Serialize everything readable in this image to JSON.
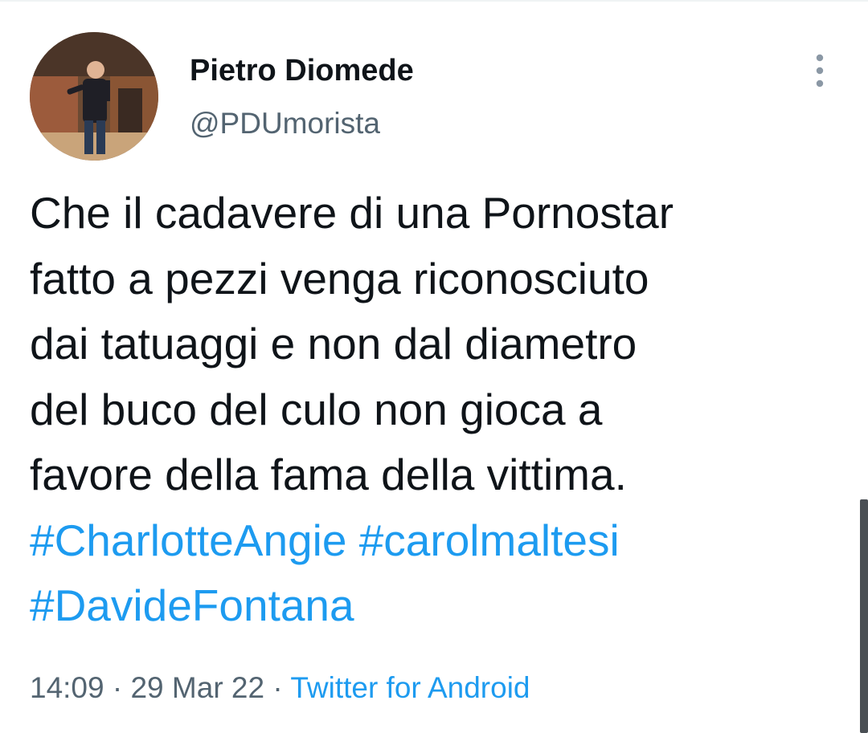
{
  "author": {
    "display_name": "Pietro Diomede",
    "handle": "@PDUmorista"
  },
  "tweet": {
    "text_lines": [
      "Che il cadavere di una Pornostar",
      "fatto a pezzi venga riconosciuto",
      "dai tatuaggi e non dal diametro",
      "del buco del culo non gioca a",
      "favore della fama della vittima."
    ],
    "hashtags": [
      "#CharlotteAngie",
      "#carolmaltesi",
      "#DavideFontana"
    ]
  },
  "meta": {
    "time": "14:09",
    "separator": "·",
    "date": "29 Mar 22",
    "source": "Twitter for Android"
  },
  "icons": {
    "more": "more-vertical-icon"
  },
  "colors": {
    "text": "#0f1419",
    "secondary": "#536471",
    "link": "#1d9bf0"
  }
}
